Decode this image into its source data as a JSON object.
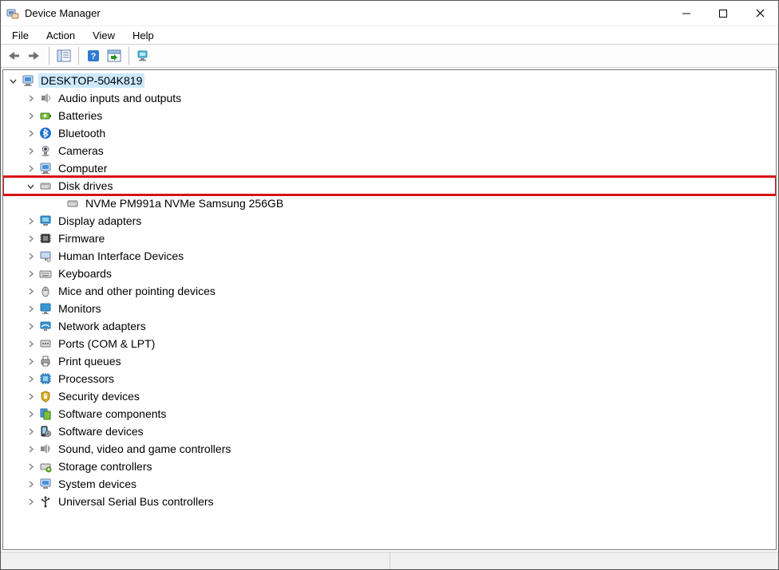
{
  "window": {
    "title": "Device Manager"
  },
  "menu": {
    "file": "File",
    "action": "Action",
    "view": "View",
    "help": "Help"
  },
  "root": {
    "name": "DESKTOP-504K819"
  },
  "categories": [
    {
      "key": "audio",
      "label": "Audio inputs and outputs",
      "icon": "speaker",
      "expanded": false
    },
    {
      "key": "batteries",
      "label": "Batteries",
      "icon": "battery",
      "expanded": false
    },
    {
      "key": "bluetooth",
      "label": "Bluetooth",
      "icon": "bluetooth",
      "expanded": false
    },
    {
      "key": "cameras",
      "label": "Cameras",
      "icon": "camera",
      "expanded": false
    },
    {
      "key": "computer",
      "label": "Computer",
      "icon": "computer",
      "expanded": false
    },
    {
      "key": "diskdrives",
      "label": "Disk drives",
      "icon": "disk",
      "expanded": true,
      "highlight": true,
      "children": [
        {
          "key": "nvme",
          "label": "NVMe PM991a NVMe Samsung 256GB",
          "icon": "disk"
        }
      ]
    },
    {
      "key": "display",
      "label": "Display adapters",
      "icon": "display",
      "expanded": false
    },
    {
      "key": "firmware",
      "label": "Firmware",
      "icon": "firmware",
      "expanded": false
    },
    {
      "key": "hid",
      "label": "Human Interface Devices",
      "icon": "hid",
      "expanded": false
    },
    {
      "key": "keyboards",
      "label": "Keyboards",
      "icon": "keyboard",
      "expanded": false
    },
    {
      "key": "mice",
      "label": "Mice and other pointing devices",
      "icon": "mouse",
      "expanded": false
    },
    {
      "key": "monitors",
      "label": "Monitors",
      "icon": "monitor",
      "expanded": false
    },
    {
      "key": "network",
      "label": "Network adapters",
      "icon": "network",
      "expanded": false
    },
    {
      "key": "ports",
      "label": "Ports (COM & LPT)",
      "icon": "port",
      "expanded": false
    },
    {
      "key": "printq",
      "label": "Print queues",
      "icon": "printer",
      "expanded": false
    },
    {
      "key": "processors",
      "label": "Processors",
      "icon": "cpu",
      "expanded": false
    },
    {
      "key": "security",
      "label": "Security devices",
      "icon": "security",
      "expanded": false
    },
    {
      "key": "softcomp",
      "label": "Software components",
      "icon": "softcomp",
      "expanded": false
    },
    {
      "key": "softdev",
      "label": "Software devices",
      "icon": "softdev",
      "expanded": false
    },
    {
      "key": "sound",
      "label": "Sound, video and game controllers",
      "icon": "sound",
      "expanded": false
    },
    {
      "key": "storage",
      "label": "Storage controllers",
      "icon": "storage",
      "expanded": false
    },
    {
      "key": "system",
      "label": "System devices",
      "icon": "system",
      "expanded": false
    },
    {
      "key": "usb",
      "label": "Universal Serial Bus controllers",
      "icon": "usb",
      "expanded": false
    }
  ]
}
